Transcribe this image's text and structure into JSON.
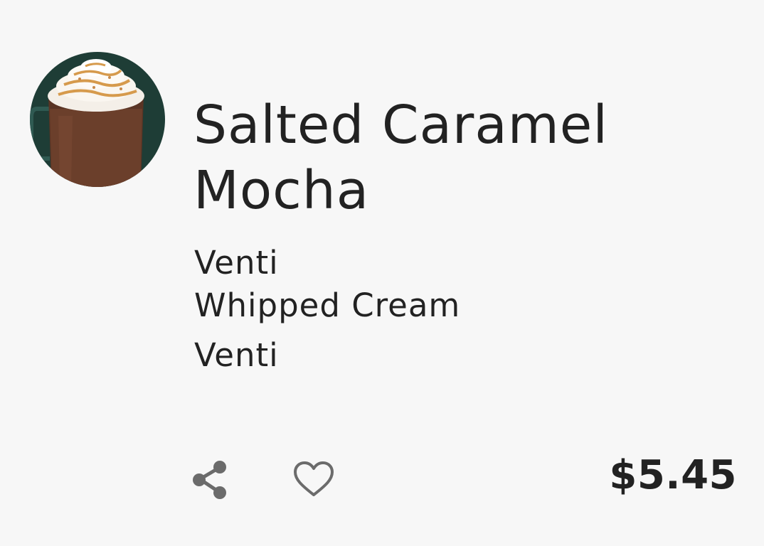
{
  "product": {
    "name": "Salted Caramel Mocha",
    "name_line1": "Salted Caramel",
    "name_line2": "Mocha",
    "image_icon": "salted-caramel-mocha-drink-photo",
    "options": [
      "Venti",
      "Whipped Cream",
      "Venti"
    ],
    "price": "$5.45"
  },
  "actions": {
    "share_icon": "share-icon",
    "favorite_icon": "heart-outline-icon"
  },
  "colors": {
    "background": "#f7f7f7",
    "text": "#222222",
    "icon": "#6b6b6b",
    "image_background": "#1e3d36"
  }
}
